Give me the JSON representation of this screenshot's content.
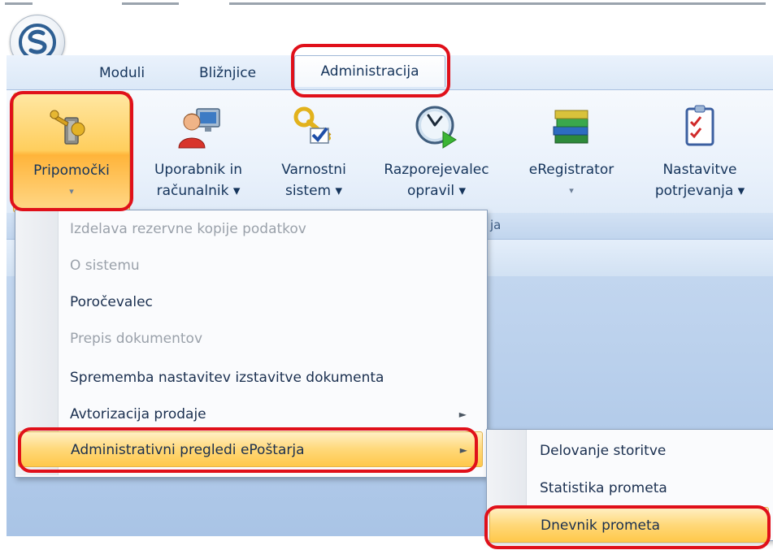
{
  "tabs": [
    "Moduli",
    "Bližnjice",
    "Administracija"
  ],
  "ribbon": {
    "buttons": [
      {
        "line1": "Pripomočki",
        "line2": "▾",
        "icon": "key-hand-icon"
      },
      {
        "line1": "Uporabnik in",
        "line2": "računalnik ▾",
        "icon": "user-computer-icon"
      },
      {
        "line1": "Varnostni",
        "line2": "sistem ▾",
        "icon": "keys-check-icon"
      },
      {
        "line1": "Razporejevalec",
        "line2": "opravil ▾",
        "icon": "clock-play-icon"
      },
      {
        "line1": "eRegistrator",
        "line2": "▾",
        "icon": "books-icon"
      },
      {
        "line1": "Nastavitve",
        "line2": "potrjevanja ▾",
        "icon": "checklist-icon"
      }
    ],
    "group_caption_fragment": "ja"
  },
  "menu": {
    "items": [
      {
        "label": "Izdelava rezervne kopije podatkov",
        "enabled": false
      },
      {
        "label": "O sistemu",
        "enabled": false
      },
      {
        "label": "Poročevalec",
        "enabled": true
      },
      {
        "label": "Prepis dokumentov",
        "enabled": false
      },
      {
        "label": "Sprememba nastavitev izstavitve dokumenta",
        "enabled": true
      },
      {
        "label": "Avtorizacija prodaje",
        "enabled": true,
        "submenu": true
      },
      {
        "label": "Administrativni pregledi ePoštarja",
        "enabled": true,
        "submenu": true,
        "highlighted": true
      }
    ],
    "submenu_arrow": "►"
  },
  "submenu": {
    "items": [
      {
        "label": "Delovanje storitve"
      },
      {
        "label": "Statistika prometa"
      },
      {
        "label": "Dnevnik prometa",
        "highlighted": true
      }
    ]
  },
  "colors": {
    "highlight": "#ffd879",
    "annotation": "#e0101a",
    "text": "#15345b"
  }
}
